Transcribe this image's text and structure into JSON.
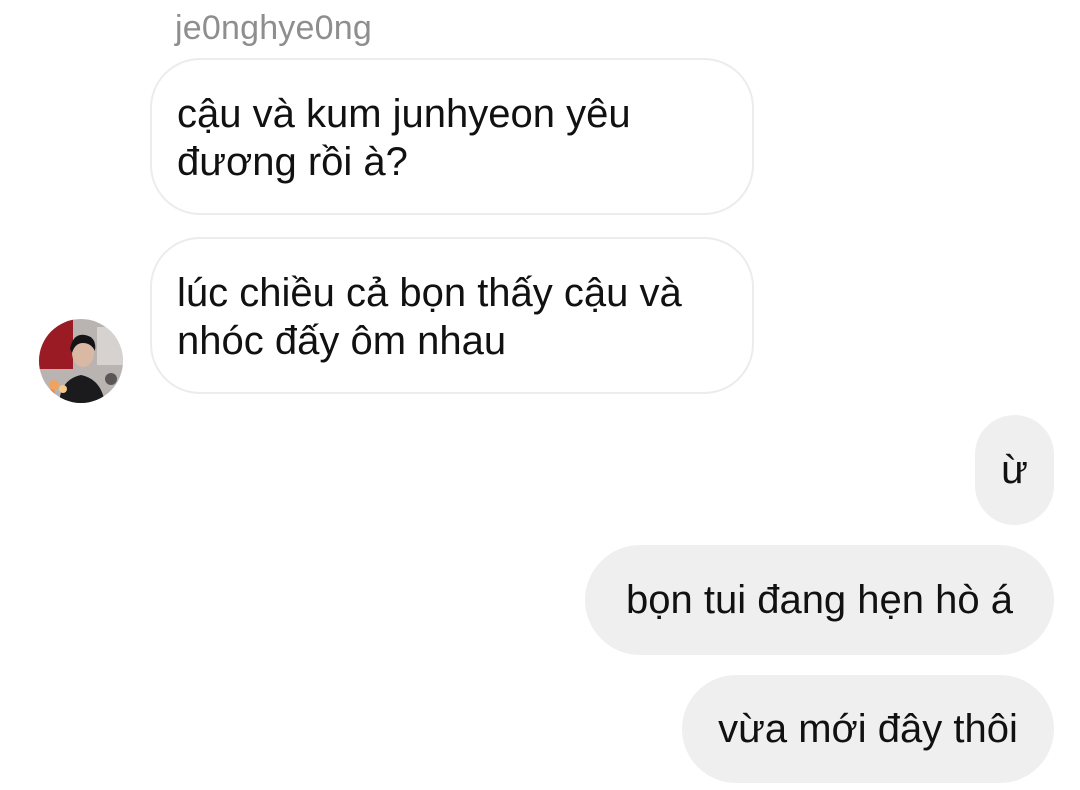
{
  "conversation": {
    "sender_name": "je0nghye0ng",
    "incoming_messages": [
      {
        "lines": [
          "cậu và kum junhyeon yêu",
          "đương rồi à?"
        ]
      },
      {
        "lines": [
          "lúc chiều cả bọn thấy cậu và",
          "nhóc đấy ôm nhau"
        ]
      }
    ],
    "outgoing_messages": [
      {
        "text": "ừ"
      },
      {
        "text": "bọn tui đang hẹn hò á"
      },
      {
        "text": "vừa mới đây thôi"
      }
    ],
    "avatar": {
      "icon": "profile-photo-icon"
    }
  },
  "colors": {
    "background": "#ffffff",
    "incoming_bubble": "#ffffff",
    "incoming_border": "#ececec",
    "outgoing_bubble": "#efefef",
    "sender_name": "#8e8e8e",
    "text": "#111111"
  }
}
